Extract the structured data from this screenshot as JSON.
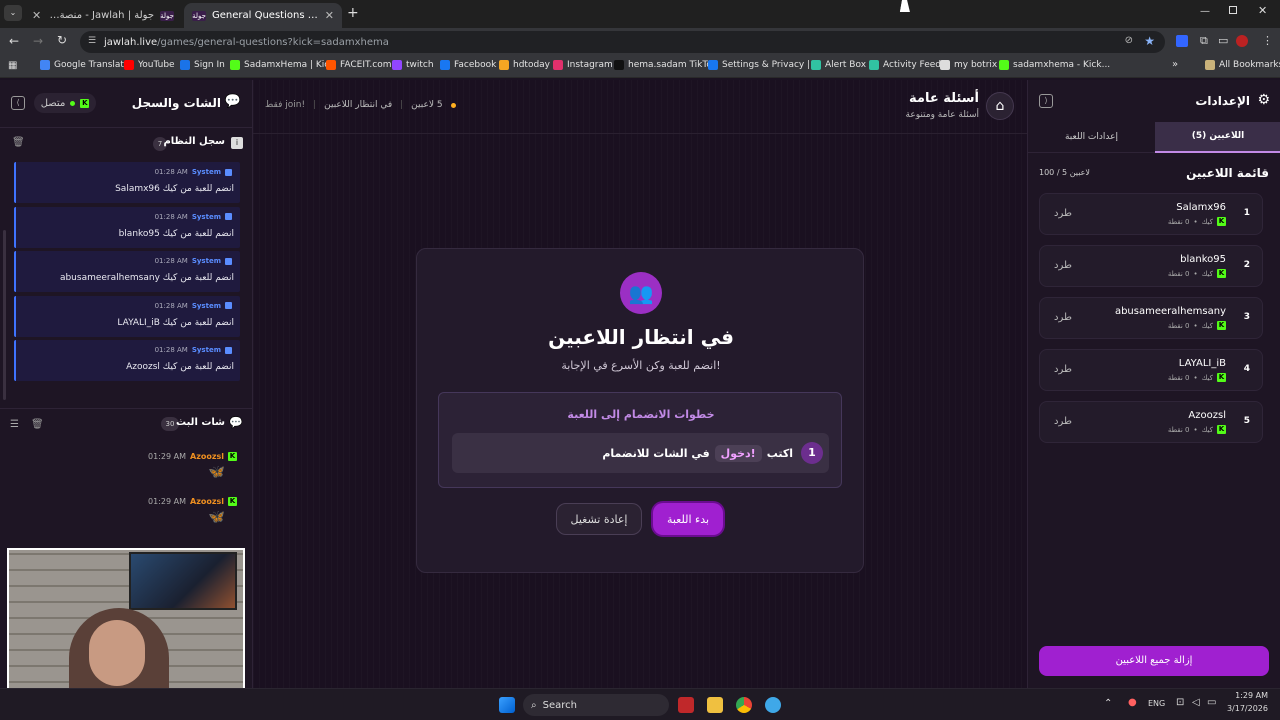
{
  "browser": {
    "tabs": [
      {
        "title": "جولة | Jawlah - منصة الألعاب الت",
        "fav": "جولة"
      },
      {
        "title": "General Questions - أسئلة عامة",
        "fav": "جولة"
      }
    ],
    "url_host": "jawlah.live",
    "url_path": "/games/general-questions?kick=sadamxhema",
    "bookmarks": [
      {
        "label": "Google Translate",
        "color": "#4285f4"
      },
      {
        "label": "YouTube",
        "color": "#ff0000"
      },
      {
        "label": "Sign In",
        "color": "#1a73e8"
      },
      {
        "label": "SadamxHema | Kick",
        "color": "#53fc18"
      },
      {
        "label": "FACEIT.com",
        "color": "#ff5500"
      },
      {
        "label": "twitch",
        "color": "#9146ff"
      },
      {
        "label": "Facebook",
        "color": "#1877f2"
      },
      {
        "label": "hdtoday",
        "color": "#f5a623"
      },
      {
        "label": "Instagram",
        "color": "#e1306c"
      },
      {
        "label": "hema.sadam TikTok",
        "color": "#111111"
      },
      {
        "label": "Settings & Privacy |...",
        "color": "#1877f2"
      },
      {
        "label": "Alert Box",
        "color": "#31c3a2"
      },
      {
        "label": "Activity Feed",
        "color": "#31c3a2"
      },
      {
        "label": "my botrix",
        "color": "#dddddd"
      },
      {
        "label": "sadamxhema - Kick...",
        "color": "#53fc18"
      }
    ],
    "all_bookmarks": "All Bookmarks"
  },
  "left": {
    "title": "الشات والسجل",
    "status": "متصل",
    "system_log": {
      "title": "سجل النظام",
      "count": "7"
    },
    "messages": [
      {
        "time": "01:28 AM",
        "sender": "System",
        "text": "Salamx96 انضم للعبة من كيك"
      },
      {
        "time": "01:28 AM",
        "sender": "System",
        "text": "blanko95 انضم للعبة من كيك"
      },
      {
        "time": "01:28 AM",
        "sender": "System",
        "text": "abusameeralhemsany انضم للعبة من كيك"
      },
      {
        "time": "01:28 AM",
        "sender": "System",
        "text": "LAYALI_iB انضم للعبة من كيك"
      },
      {
        "time": "01:28 AM",
        "sender": "System",
        "text": "Azoozsl انضم للعبة من كيك"
      }
    ],
    "stream_chat": {
      "title": "شات البث",
      "count": "30"
    },
    "chat": [
      {
        "time": "01:29 AM",
        "user": "Azoozsl",
        "emote": "🦋"
      },
      {
        "time": "01:29 AM",
        "user": "Azoozsl",
        "emote": "🦋"
      }
    ]
  },
  "center": {
    "game_title": "أسئلة عامة",
    "game_subtitle": "أسئلة عامة ومتنوعة",
    "players_count": "5 لاعبين",
    "state": "في انتظار اللاعبين",
    "join_hint": "!join فقط",
    "heading": "في انتظار اللاعبين",
    "subheading": "انضم للعبة وكن الأسرع في الإجابة!",
    "steps_title": "خطوات الانضمام إلى اللعبة",
    "step_num": "1",
    "step_write": "اكتب",
    "step_cmd": "!دخول",
    "step_rest": "في الشات للانضمام",
    "start_btn": "بدء اللعبة",
    "restart_btn": "إعادة تشغيل"
  },
  "right": {
    "title": "الإعدادات",
    "tab_players": "اللاعبين (5)",
    "tab_settings": "إعدادات اللعبة",
    "list_title": "قائمة اللاعبين",
    "capacity": "100 / 5 لاعبين",
    "players": [
      {
        "rank": "1",
        "name": "Salamx96",
        "points": "0 نقطة",
        "platform": "كيك",
        "kick": "طرد"
      },
      {
        "rank": "2",
        "name": "blanko95",
        "points": "0 نقطة",
        "platform": "كيك",
        "kick": "طرد"
      },
      {
        "rank": "3",
        "name": "abusameeralhemsany",
        "points": "0 نقطة",
        "platform": "كيك",
        "kick": "طرد"
      },
      {
        "rank": "4",
        "name": "LAYALI_iB",
        "points": "0 نقطة",
        "platform": "كيك",
        "kick": "طرد"
      },
      {
        "rank": "5",
        "name": "Azoozsl",
        "points": "0 نقطة",
        "platform": "كيك",
        "kick": "طرد"
      }
    ],
    "remove_all": "إزالة جميع اللاعبين"
  },
  "taskbar": {
    "search": "Search",
    "lang": "ENG",
    "time": "1:29 AM",
    "date": "3/17/2026"
  },
  "colors": {
    "accent": "#a020d0",
    "kick": "#53fc18",
    "system": "#3f73ff"
  }
}
